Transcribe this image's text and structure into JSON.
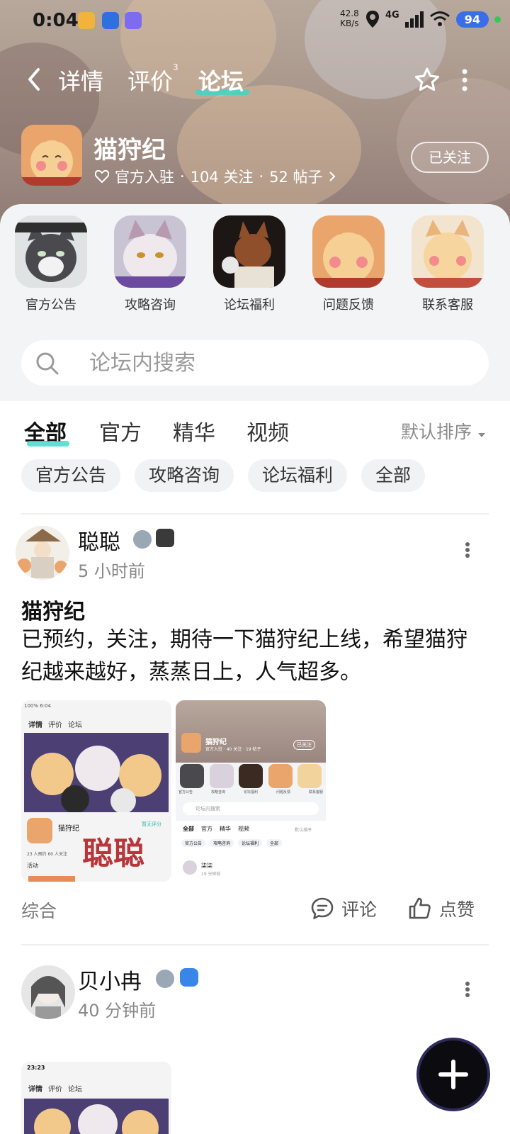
{
  "status_bar": {
    "time": "0:04",
    "net_speed_value": "42.8",
    "net_speed_unit": "KB/s",
    "network": "4G",
    "battery": "94"
  },
  "nav": {
    "tabs": [
      {
        "label": "详情"
      },
      {
        "label": "评价",
        "superscript": "3"
      },
      {
        "label": "论坛"
      }
    ]
  },
  "forum": {
    "name": "猫狩纪",
    "badge": "官方入驻",
    "followers": "104 关注",
    "posts": "52 帖子",
    "follow_label": "已关注"
  },
  "categories": [
    {
      "label": "官方公告"
    },
    {
      "label": "攻略咨询"
    },
    {
      "label": "论坛福利"
    },
    {
      "label": "问题反馈"
    },
    {
      "label": "联系客服"
    }
  ],
  "search": {
    "placeholder": "论坛内搜索"
  },
  "filters": {
    "tabs": [
      {
        "label": "全部"
      },
      {
        "label": "官方"
      },
      {
        "label": "精华"
      },
      {
        "label": "视频"
      }
    ],
    "sort_label": "默认排序",
    "chips": [
      {
        "label": "官方公告"
      },
      {
        "label": "攻略咨询"
      },
      {
        "label": "论坛福利"
      },
      {
        "label": "全部"
      }
    ]
  },
  "posts": [
    {
      "author": "聪聪",
      "time": "5 小时前",
      "title": "猫狩纪",
      "body": "已预约，关注，期待一下猫狩纪上线，希望猫狩纪越来越好，蒸蒸日上，人气超多。",
      "thumb1": {
        "tabs": [
          "详情",
          "评价",
          "论坛"
        ],
        "game": "猫狩纪",
        "rating": "暂无评分",
        "stats": "23 人预约   60 人关注",
        "activity": "活动",
        "watermark": "聪聪",
        "battery": "100%",
        "time": "6:04"
      },
      "thumb2": {
        "game": "猫狩纪",
        "meta": "官方入驻 · 40 关注 · 19 帖子",
        "follow": "已关注",
        "icons": [
          "官方公告",
          "攻略咨询",
          "论坛福利",
          "问题反馈",
          "联系客服"
        ],
        "search": "论坛内搜索",
        "tabs": [
          "全部",
          "官方",
          "精华",
          "视频"
        ],
        "sort": "默认排序",
        "chips": [
          "官方公告",
          "攻略咨询",
          "论坛福利",
          "全部"
        ],
        "author": "柒柒",
        "time": "19 分钟前"
      },
      "tag": "综合",
      "comment_label": "评论",
      "like_label": "点赞"
    },
    {
      "author": "贝小冉",
      "time": "40 分钟前",
      "thumb": {
        "time": "23:23",
        "tabs": [
          "详情",
          "评价",
          "论坛"
        ]
      }
    }
  ],
  "colors": {
    "accent": "#3ad7c8",
    "battery_badge": "#3a6ee8",
    "fab": "#0c0c10"
  }
}
